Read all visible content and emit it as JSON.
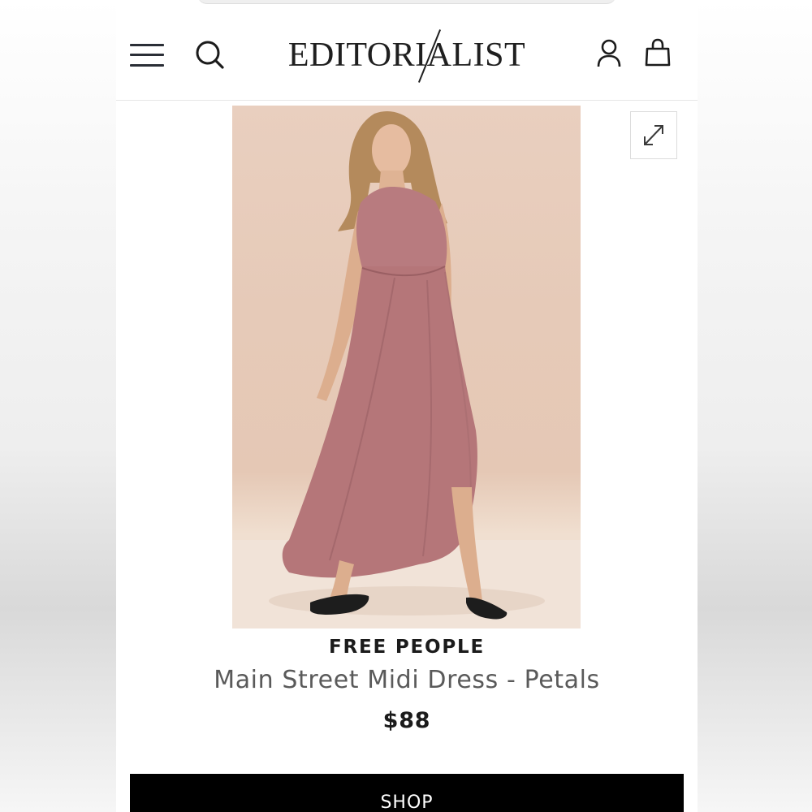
{
  "header": {
    "logo_text": "EDITORIALIST",
    "menu_icon": "hamburger-menu-icon",
    "search_icon": "search-icon",
    "account_icon": "user-icon",
    "bag_icon": "shopping-bag-icon"
  },
  "product": {
    "image_alt": "Woman wearing a mauve pink halter midi dress with asymmetric hem and black flip flops",
    "expand_icon": "expand-icon",
    "brand": "FREE PEOPLE",
    "name": "Main Street Midi Dress - Petals",
    "price": "$88"
  },
  "actions": {
    "shop_label": "SHOP"
  },
  "colors": {
    "text_dark": "#1b1b1b",
    "text_gray": "#5a5a5a",
    "button_bg": "#000000",
    "dress": "#b87b7f",
    "backdrop": "#e6cab8"
  }
}
